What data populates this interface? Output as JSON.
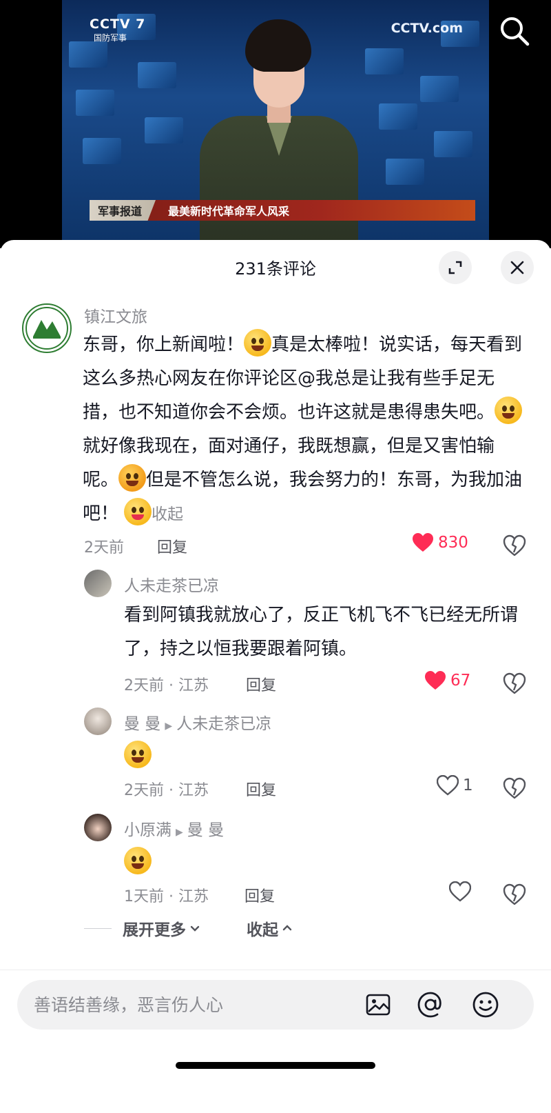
{
  "video": {
    "channel_logo": "CCTV 7",
    "channel_sub": "国防军事",
    "network_logo": "CCTV.com",
    "banner_tag": "军事报道",
    "banner_title": "最美新时代革命军人风采"
  },
  "comments_panel": {
    "title": "231条评论",
    "comments": [
      {
        "user": "镇江文旅",
        "text_parts": [
          "东哥，你上新闻啦！",
          "真是太棒啦！说实话，每天看到这么多热心网友在你评论区@我总是让我有些手足无措，也不知道你会不会烦。也许这就是患得患失吧。",
          "就好像我现在，面对通仔，我既想赢，但是又害怕输呢。",
          "但是不管怎么说，我会努力的！东哥，为我加油吧！"
        ],
        "collapse_label": "收起",
        "time": "2天前",
        "reply_label": "回复",
        "likes": "830"
      },
      {
        "user": "人未走茶已凉",
        "text": "看到阿镇我就放心了，反正飞机飞不飞已经无所谓了，持之以恒我要跟着阿镇。",
        "time": "2天前 · 江苏",
        "reply_label": "回复",
        "likes": "67"
      },
      {
        "user": "曼 曼",
        "reply_to": "人未走茶已凉",
        "time": "2天前 · 江苏",
        "reply_label": "回复",
        "likes": "1"
      },
      {
        "user": "小原满",
        "reply_to": "曼 曼",
        "time": "1天前 · 江苏",
        "reply_label": "回复",
        "likes": ""
      }
    ],
    "expand_more": "展开更多",
    "collapse": "收起"
  },
  "input": {
    "placeholder": "善语结善缘，恶言伤人心"
  },
  "colors": {
    "like_red": "#fe2c55",
    "secondary_text": "#8a8b91",
    "primary_text": "#161823"
  }
}
